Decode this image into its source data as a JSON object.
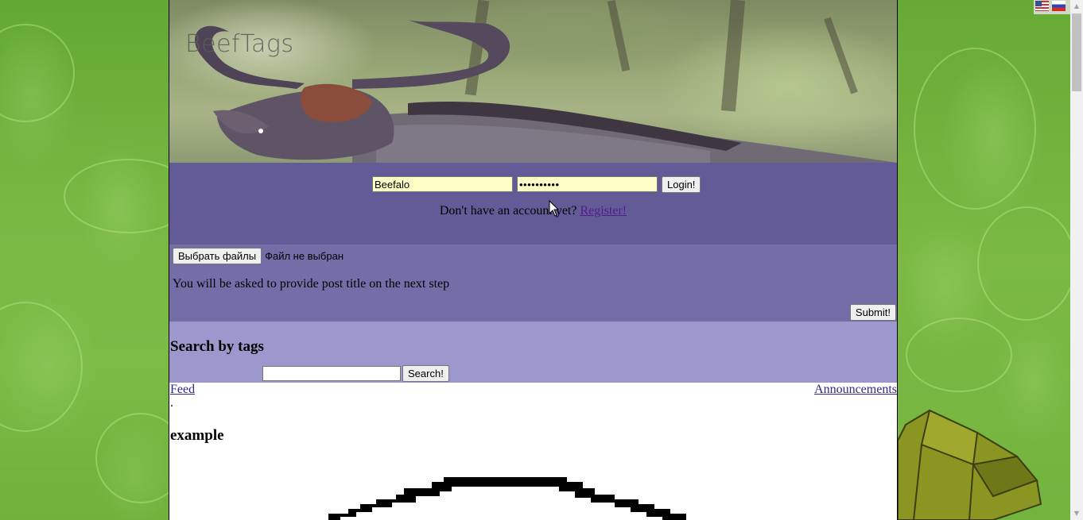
{
  "site": {
    "title": "BeefTags"
  },
  "languages": {
    "items": [
      {
        "name": "english-flag-icon"
      },
      {
        "name": "russian-flag-icon"
      }
    ]
  },
  "login": {
    "username_value": "Beefalo",
    "password_value": "••••••••••",
    "login_label": "Login!",
    "no_account_text": "Don't have an account yet?",
    "register_label": "Register!"
  },
  "upload": {
    "choose_files_label": "Выбрать файлы",
    "no_file_text": "Файл не выбран",
    "hint_text": "You will be asked to provide post title on the next step",
    "submit_label": "Submit!"
  },
  "search": {
    "title": "Search by tags",
    "input_value": "",
    "button_label": "Search!"
  },
  "nav": {
    "feed_label": "Feed",
    "announcements_label": "Announcements",
    "separator": "."
  },
  "post": {
    "title": "example"
  },
  "colors": {
    "login_panel": "#625b97",
    "upload_panel": "#746ea8",
    "search_panel": "#9c98cd",
    "input_bg": "#fdffc6",
    "page_bg": "#6db03c"
  }
}
